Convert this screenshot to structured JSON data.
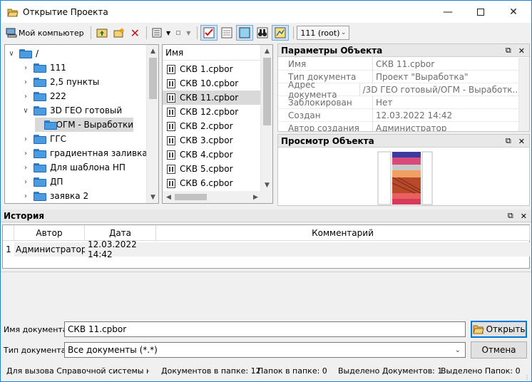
{
  "window": {
    "title": "Открытие Проекта"
  },
  "toolbar": {
    "my_computer": "Мой компьютер",
    "filter_value": "111 (root)"
  },
  "tree": {
    "items": [
      {
        "label": "/",
        "chev": "v"
      },
      {
        "label": "111",
        "chev": ">"
      },
      {
        "label": "2,5 пункты",
        "chev": ">"
      },
      {
        "label": "222",
        "chev": ">"
      },
      {
        "label": "3D ГЕО готовый",
        "chev": "v"
      },
      {
        "label": "ОГМ - Выработки",
        "chev": ""
      },
      {
        "label": "ГГС",
        "chev": ">"
      },
      {
        "label": "градиентная заливка",
        "chev": ">"
      },
      {
        "label": "Для шаблона НП",
        "chev": ">"
      },
      {
        "label": "ДП",
        "chev": ">"
      },
      {
        "label": "заявка 2",
        "chev": ">"
      }
    ]
  },
  "files": {
    "header": "Имя",
    "items": [
      "СКВ 1.cpbor",
      "СКВ 10.cpbor",
      "СКВ 11.cpbor",
      "СКВ 12.cpbor",
      "СКВ 2.cpbor",
      "СКВ 3.cpbor",
      "СКВ 4.cpbor",
      "СКВ 5.cpbor",
      "СКВ 6.cpbor"
    ]
  },
  "props": {
    "title": "Параметры Объекта",
    "rows": [
      {
        "k": "Имя",
        "v": "СКВ 11.cpbor"
      },
      {
        "k": "Тип документа",
        "v": "Проект \"Выработка\""
      },
      {
        "k": "Адрес документа",
        "v": "/3D ГЕО готовый/ОГМ - Выработк..."
      },
      {
        "k": "Заблокирован",
        "v": "Нет"
      },
      {
        "k": "Создан",
        "v": "12.03.2022 14:42"
      },
      {
        "k": "Автор создания",
        "v": "Администратор"
      }
    ]
  },
  "preview": {
    "title": "Просмотр Объекта"
  },
  "history": {
    "title": "История",
    "columns": [
      "Автор",
      "Дата",
      "Комментарий"
    ],
    "rows": [
      {
        "n": "1",
        "author": "Администратор",
        "date": "12.03.2022 14:42",
        "comment": ""
      }
    ]
  },
  "form": {
    "name_label": "Имя документа:",
    "name_value": "СКВ 11.cpbor",
    "type_label": "Тип документа:",
    "type_value": "Все документы (*.*)",
    "open_button": "Открыть",
    "cancel_button": "Отмена"
  },
  "status": {
    "help": "Для вызова Справочной системы на",
    "docs_in_folder": "Документов в папке: 12",
    "folders_in_folder": "Папок в папке: 0",
    "docs_selected": "Выделено Документов: 1",
    "folders_selected": "Выделено Папок: 0"
  },
  "colors": {
    "accent": "#0078d7",
    "selection": "#d9d9d9",
    "folder": "#4a9be0"
  }
}
